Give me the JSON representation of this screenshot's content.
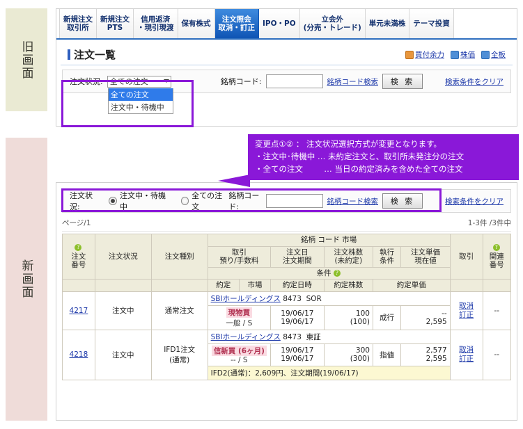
{
  "bands": {
    "old": "旧画面",
    "new": "新画面"
  },
  "tabs": [
    {
      "l1": "新規注文",
      "l2": "取引所",
      "active": false
    },
    {
      "l1": "新規注文",
      "l2": "PTS",
      "active": false
    },
    {
      "l1": "信用返済",
      "l2": "・現引現渡",
      "active": false
    },
    {
      "l1": "保有株式",
      "l2": "",
      "active": false
    },
    {
      "l1": "注文照会",
      "l2": "取消・訂正",
      "active": true
    },
    {
      "l1": "IPO・PO",
      "l2": "",
      "active": false
    },
    {
      "l1": "立会外",
      "l2": "(分売・トレード)",
      "active": false
    },
    {
      "l1": "単元未満株",
      "l2": "",
      "active": false
    },
    {
      "l1": "テーマ投資",
      "l2": "",
      "active": false
    }
  ],
  "header": {
    "title": "注文一覧",
    "links": [
      {
        "label": "買付余力",
        "icon": "orange-panel-icon"
      },
      {
        "label": "株価",
        "icon": "blue-panel-icon"
      },
      {
        "label": "全板",
        "icon": "blue-panel-icon"
      }
    ]
  },
  "search_old": {
    "status_label": "注文状況:",
    "selected": "全ての注文",
    "options": [
      {
        "label": "全ての注文",
        "highlighted": true
      },
      {
        "label": "注文中・待機中",
        "highlighted": false
      }
    ],
    "code_label": "銘柄コード:",
    "code_value": "",
    "code_search_link": "銘柄コード検索",
    "search_button": "検 索",
    "clear_link": "検索条件をクリア"
  },
  "search_new": {
    "status_label": "注文状況:",
    "radios": [
      {
        "label": "注文中・待機中",
        "selected": true
      },
      {
        "label": "全ての注文",
        "selected": false
      }
    ],
    "code_label": "銘柄コード:",
    "code_value": "",
    "code_search_link": "銘柄コード検索",
    "search_button": "検 索",
    "clear_link": "検索条件をクリア"
  },
  "callout": {
    "line1": "変更点①② ： 注文状況選択方式が変更となります。",
    "line2": "・注文中･待機中 … 未約定注文と、取引所未発注分の注文",
    "line3": "・全ての注文 　　 … 当日の約定済みを含めた全ての注文",
    "color": "#8a18d8"
  },
  "paging": {
    "left": "ページ/1",
    "right": "1-3件 /3件中"
  },
  "table": {
    "headers": {
      "order_no": "注文\n番号",
      "order_no_l1": "注文",
      "order_no_l2": "番号",
      "order_status": "注文状況",
      "order_type": "注文種別",
      "symbol_group": "銘柄 コード 市場",
      "trade_l1": "取引",
      "trade_l2": "預り/手数料",
      "date_l1": "注文日",
      "date_l2": "注文期間",
      "qty_l1": "注文株数",
      "qty_l2": "(未約定)",
      "exec_l1": "執行",
      "exec_l2": "条件",
      "price_l1": "注文単価",
      "price_l2": "現在値",
      "condition": "条件",
      "contract": "約定",
      "market": "市場",
      "contract_datetime": "約定日時",
      "contract_qty": "約定株数",
      "contract_price": "約定単価",
      "trade_col": "取引",
      "related_l1": "関連",
      "related_l2": "番号"
    },
    "rows": [
      {
        "order_no": "4217",
        "order_status": "注文中",
        "order_type_l1": "通常注文",
        "order_type_l2": "",
        "symbol_name": "SBIホールディングス",
        "symbol_code": "8473",
        "symbol_market": "SOR",
        "trade_tag": "現物買",
        "trade_sub": "一般 / S",
        "order_date": "19/06/17",
        "order_period": "19/06/17",
        "qty": "100",
        "qty_unfilled": "(100)",
        "exec_cond": "成行",
        "order_price": "--",
        "current_price": "2,595",
        "action_l1": "取消",
        "action_l2": "訂正",
        "related_no": "--",
        "ifd_note": ""
      },
      {
        "order_no": "4218",
        "order_status": "注文中",
        "order_type_l1": "IFD1注文",
        "order_type_l2": "(通常)",
        "symbol_name": "SBIホールディングス",
        "symbol_code": "8473",
        "symbol_market": "東証",
        "trade_tag": "信新買 (6ヶ月)",
        "trade_sub": "-- / S",
        "order_date": "19/06/17",
        "order_period": "19/06/17",
        "qty": "300",
        "qty_unfilled": "(300)",
        "exec_cond": "指値",
        "order_price": "2,577",
        "current_price": "2,595",
        "action_l1": "取消",
        "action_l2": "訂正",
        "related_no": "--",
        "ifd_note": "IFD2(通常)：2,609円、注文期間(19/06/17)"
      }
    ]
  }
}
